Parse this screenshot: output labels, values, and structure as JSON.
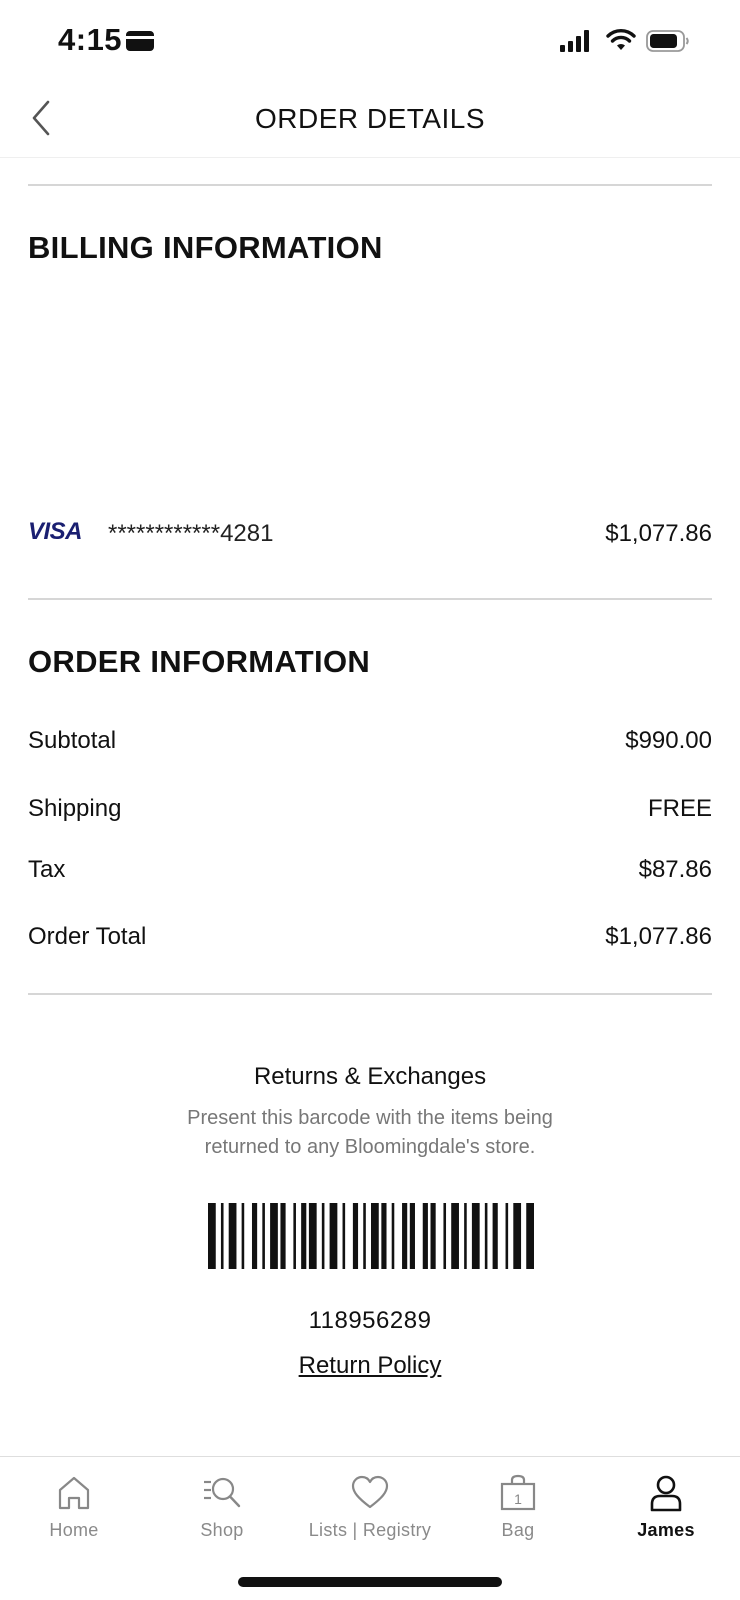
{
  "status_bar": {
    "time": "4:15"
  },
  "header": {
    "title": "ORDER DETAILS"
  },
  "billing": {
    "title": "BILLING INFORMATION",
    "card_brand": "VISA",
    "card_number": "************4281",
    "amount": "$1,077.86"
  },
  "order": {
    "title": "ORDER INFORMATION",
    "rows": [
      {
        "label": "Subtotal",
        "value": "$990.00"
      },
      {
        "label": "Shipping",
        "value": "FREE"
      },
      {
        "label": "Tax",
        "value": "$87.86"
      },
      {
        "label": "Order Total",
        "value": "$1,077.86"
      }
    ]
  },
  "returns": {
    "title": "Returns & Exchanges",
    "description": "Present this barcode with the items being returned to any Bloomingdale's store.",
    "barcode_number": "118956289",
    "policy_link": "Return Policy"
  },
  "tab_bar": {
    "bag_count": "1",
    "items": [
      {
        "label": "Home",
        "icon": "home-icon"
      },
      {
        "label": "Shop",
        "icon": "shop-search-icon"
      },
      {
        "label": "Lists | Registry",
        "icon": "heart-icon"
      },
      {
        "label": "Bag",
        "icon": "bag-icon"
      },
      {
        "label": "James",
        "icon": "person-icon"
      }
    ],
    "active": "James"
  },
  "colors": {
    "text": "#111111",
    "muted": "#777777",
    "divider": "#d6d6d6",
    "tab_inactive": "#8a8a8a",
    "visa_blue": "#1a1f71",
    "visa_gold": "#f7b600"
  }
}
